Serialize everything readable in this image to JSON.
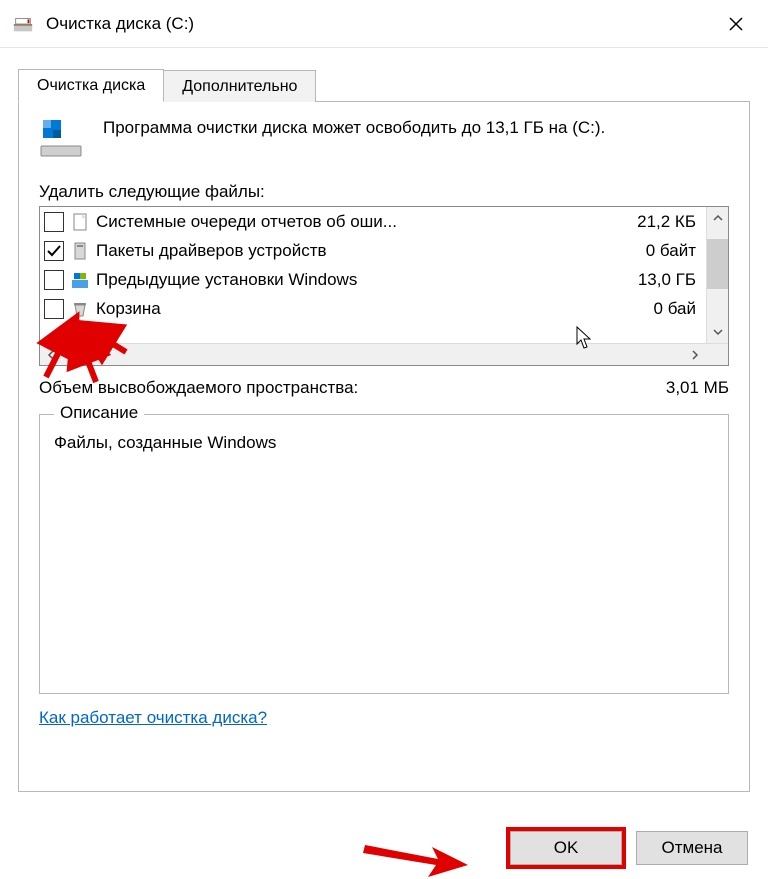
{
  "title": "Очистка диска  (C:)",
  "tabs": [
    {
      "label": "Очистка диска"
    },
    {
      "label": "Дополнительно"
    }
  ],
  "summary": "Программа очистки диска может освободить до 13,1 ГБ на  (C:).",
  "files_label": "Удалить следующие файлы:",
  "files": [
    {
      "checked": false,
      "icon": "file",
      "name": "Системные очереди отчетов об оши...",
      "size": "21,2 КБ"
    },
    {
      "checked": true,
      "icon": "driver",
      "name": "Пакеты драйверов устройств",
      "size": "0 байт"
    },
    {
      "checked": false,
      "icon": "win",
      "name": "Предыдущие установки Windows",
      "size": "13,0 ГБ"
    },
    {
      "checked": false,
      "icon": "bin",
      "name": "Корзина",
      "size": "0 бай"
    }
  ],
  "total_label": "Объем высвобождаемого пространства:",
  "total_value": "3,01 МБ",
  "group": {
    "legend": "Описание",
    "body": "Файлы, созданные Windows"
  },
  "help_link": "Как работает очистка диска?",
  "buttons": {
    "ok": "OK",
    "cancel": "Отмена"
  }
}
